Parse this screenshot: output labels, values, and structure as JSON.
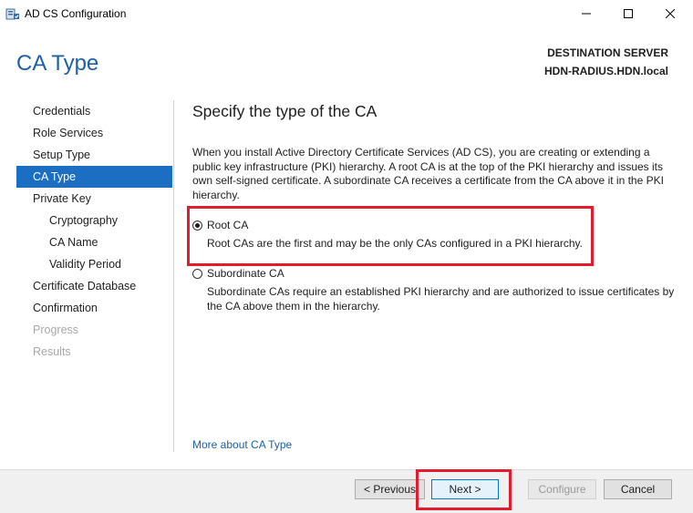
{
  "window": {
    "title": "AD CS Configuration",
    "app_icon": "server-icon"
  },
  "header": {
    "page_title": "CA Type",
    "destination_label": "DESTINATION SERVER",
    "destination_server": "HDN-RADIUS.HDN.local"
  },
  "nav": {
    "items": [
      {
        "label": "Credentials"
      },
      {
        "label": "Role Services"
      },
      {
        "label": "Setup Type"
      },
      {
        "label": "CA Type"
      },
      {
        "label": "Private Key"
      },
      {
        "label": "Cryptography"
      },
      {
        "label": "CA Name"
      },
      {
        "label": "Validity Period"
      },
      {
        "label": "Certificate Database"
      },
      {
        "label": "Confirmation"
      },
      {
        "label": "Progress"
      },
      {
        "label": "Results"
      }
    ],
    "active": "CA Type"
  },
  "content": {
    "section_title": "Specify the type of the CA",
    "description": "When you install Active Directory Certificate Services (AD CS), you are creating or extending a public key infrastructure (PKI) hierarchy. A root CA is at the top of the PKI hierarchy and issues its own self-signed certificate. A subordinate CA receives a certificate from the CA above it in the PKI hierarchy.",
    "options": [
      {
        "label": "Root CA",
        "description": "Root CAs are the first and may be the only CAs configured in a PKI hierarchy.",
        "selected": true
      },
      {
        "label": "Subordinate CA",
        "description": "Subordinate CAs require an established PKI hierarchy and are authorized to issue certificates by the CA above them in the hierarchy.",
        "selected": false
      }
    ],
    "more_link": "More about CA Type"
  },
  "footer": {
    "previous_label": "< Previous",
    "next_label": "Next >",
    "configure_label": "Configure",
    "cancel_label": "Cancel"
  },
  "colors": {
    "accent": "#1c6ec2",
    "highlight": "#e21b2d",
    "title_blue": "#1f5fa6"
  }
}
